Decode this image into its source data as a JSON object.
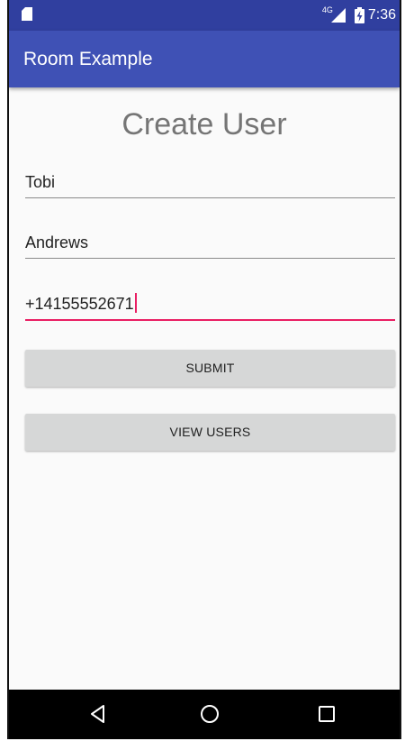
{
  "status_bar": {
    "network_type": "4G",
    "time": "7:36"
  },
  "app_bar": {
    "title": "Room Example"
  },
  "form": {
    "heading": "Create User",
    "first_name_value": "Tobi",
    "last_name_value": "Andrews",
    "phone_value": "+14155552671",
    "submit_label": "SUBMIT",
    "view_users_label": "VIEW USERS"
  },
  "nav_bar": {
    "icons": [
      "back-icon",
      "home-icon",
      "recents-icon"
    ]
  },
  "colors": {
    "status_bar": "#303f9f",
    "app_bar": "#3f51b5",
    "accent": "#e91e63",
    "button": "#d6d7d7"
  }
}
